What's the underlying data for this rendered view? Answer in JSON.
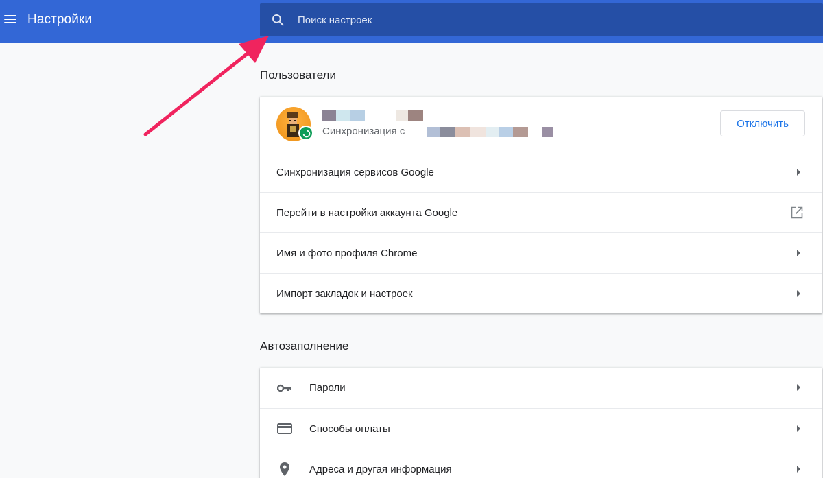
{
  "header": {
    "title": "Настройки",
    "search_placeholder": "Поиск настроек"
  },
  "users": {
    "section_title": "Пользователи",
    "profile": {
      "sync_label": "Синхронизация с",
      "disconnect_label": "Отключить"
    },
    "items": [
      {
        "label": "Синхронизация сервисов Google",
        "icon": "arrow-right"
      },
      {
        "label": "Перейти в настройки аккаунта Google",
        "icon": "external-link"
      },
      {
        "label": "Имя и фото профиля Chrome",
        "icon": "arrow-right"
      },
      {
        "label": "Импорт закладок и настроек",
        "icon": "arrow-right"
      }
    ]
  },
  "autofill": {
    "section_title": "Автозаполнение",
    "items": [
      {
        "label": "Пароли",
        "icon": "key-icon"
      },
      {
        "label": "Способы оплаты",
        "icon": "credit-card-icon"
      },
      {
        "label": "Адреса и другая информация",
        "icon": "location-pin-icon"
      }
    ]
  },
  "colors": {
    "header_bg": "#3367d6",
    "search_bg": "#254fa6",
    "accent": "#1a73e8",
    "annotation_arrow": "#f0245e"
  }
}
